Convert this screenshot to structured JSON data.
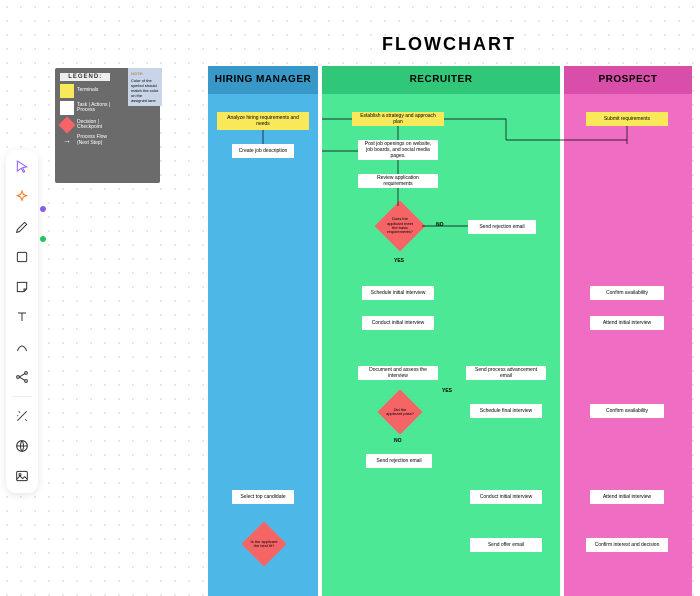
{
  "title": "FLOWCHART",
  "legend": {
    "header": "LEGEND:",
    "terminals": "Terminals",
    "task": "Task | Actions | Process",
    "decision": "Decision | Checkpoint",
    "flow": "Process Flow\n(Next Step)"
  },
  "note": {
    "heading": "NOTE:",
    "body": "Color of the symbol should match the color on the assigned lane"
  },
  "lanes": {
    "l1": "HIRING MANAGER",
    "l2": "RECRUITER",
    "l3": "PROSPECT"
  },
  "n": {
    "hm1": "Analyze hiring requirements and needs",
    "hm2": "Create job description",
    "hm3": "Select top candidate",
    "hm4": "Is the applicant the best fit?",
    "r1": "Establish a strategy and approach plan",
    "r2": "Post job openings on website, job boards, and social media pages.",
    "r3": "Review application requirements",
    "r4": "Does the applicant meet the basic requirements?",
    "r5": "Send rejection email",
    "r6": "Schedule initial interview",
    "r7": "Conduct initial interview",
    "r8": "Document and assess the interview",
    "r9": "Send process advancement email",
    "r10": "Did the applicant pass?",
    "r11": "Schedule final interview",
    "r12": "Send rejection email",
    "r13": "Conduct initial interview",
    "r14": "Send offer email",
    "p1": "Submit requirements",
    "p2": "Confirm availability",
    "p3": "Attend initial interview",
    "p4": "Confirm availability",
    "p5": "Attend initial interview",
    "p6": "Confirm interest and decision"
  },
  "lbls": {
    "yes": "YES",
    "no": "NO"
  }
}
